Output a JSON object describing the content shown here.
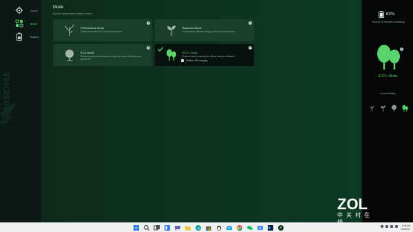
{
  "sidebar": {
    "brand": "VEROSENSE",
    "items": [
      {
        "label": "Home",
        "icon": "settings-gear-icon"
      },
      {
        "label": "Mode",
        "icon": "mode-grid-icon"
      },
      {
        "label": "Battery",
        "icon": "battery-icon"
      }
    ]
  },
  "main": {
    "title": "Mode",
    "subtitle": "Specific optimization battery modes",
    "cards": [
      {
        "title": "Performance Mode",
        "desc": "Optimized for the best overall performance",
        "icon": "bare-tree-icon",
        "selected": false
      },
      {
        "title": "Balanced Mode",
        "desc": "Automatically balance energy saving and performance",
        "icon": "sprout-icon",
        "selected": false
      },
      {
        "title": "ECO Mode",
        "desc": "Reduces system performance to improve power efficiency and battery life",
        "icon": "tree-icon",
        "selected": false
      },
      {
        "title": "ECO+ Mode",
        "desc": "Extreme battery saving with critical functions disabled",
        "icon": "twin-trees-icon",
        "selected": true,
        "checkbox_label": "Disable USB charging",
        "checkbox_checked": true
      }
    ],
    "info_glyph": "i",
    "check_glyph": "✓"
  },
  "status": {
    "battery_percent": "83%",
    "remaining": "5 hours 25 minutes remaining",
    "mode_label": "ECO+ Mode",
    "current_status_label": "Current Status",
    "accent": "#59d36b"
  },
  "taskbar": {
    "time": "8:46 AM",
    "date": "10/2/2021"
  },
  "watermark": {
    "logo": "ZOL",
    "sub": "中关村在线"
  }
}
